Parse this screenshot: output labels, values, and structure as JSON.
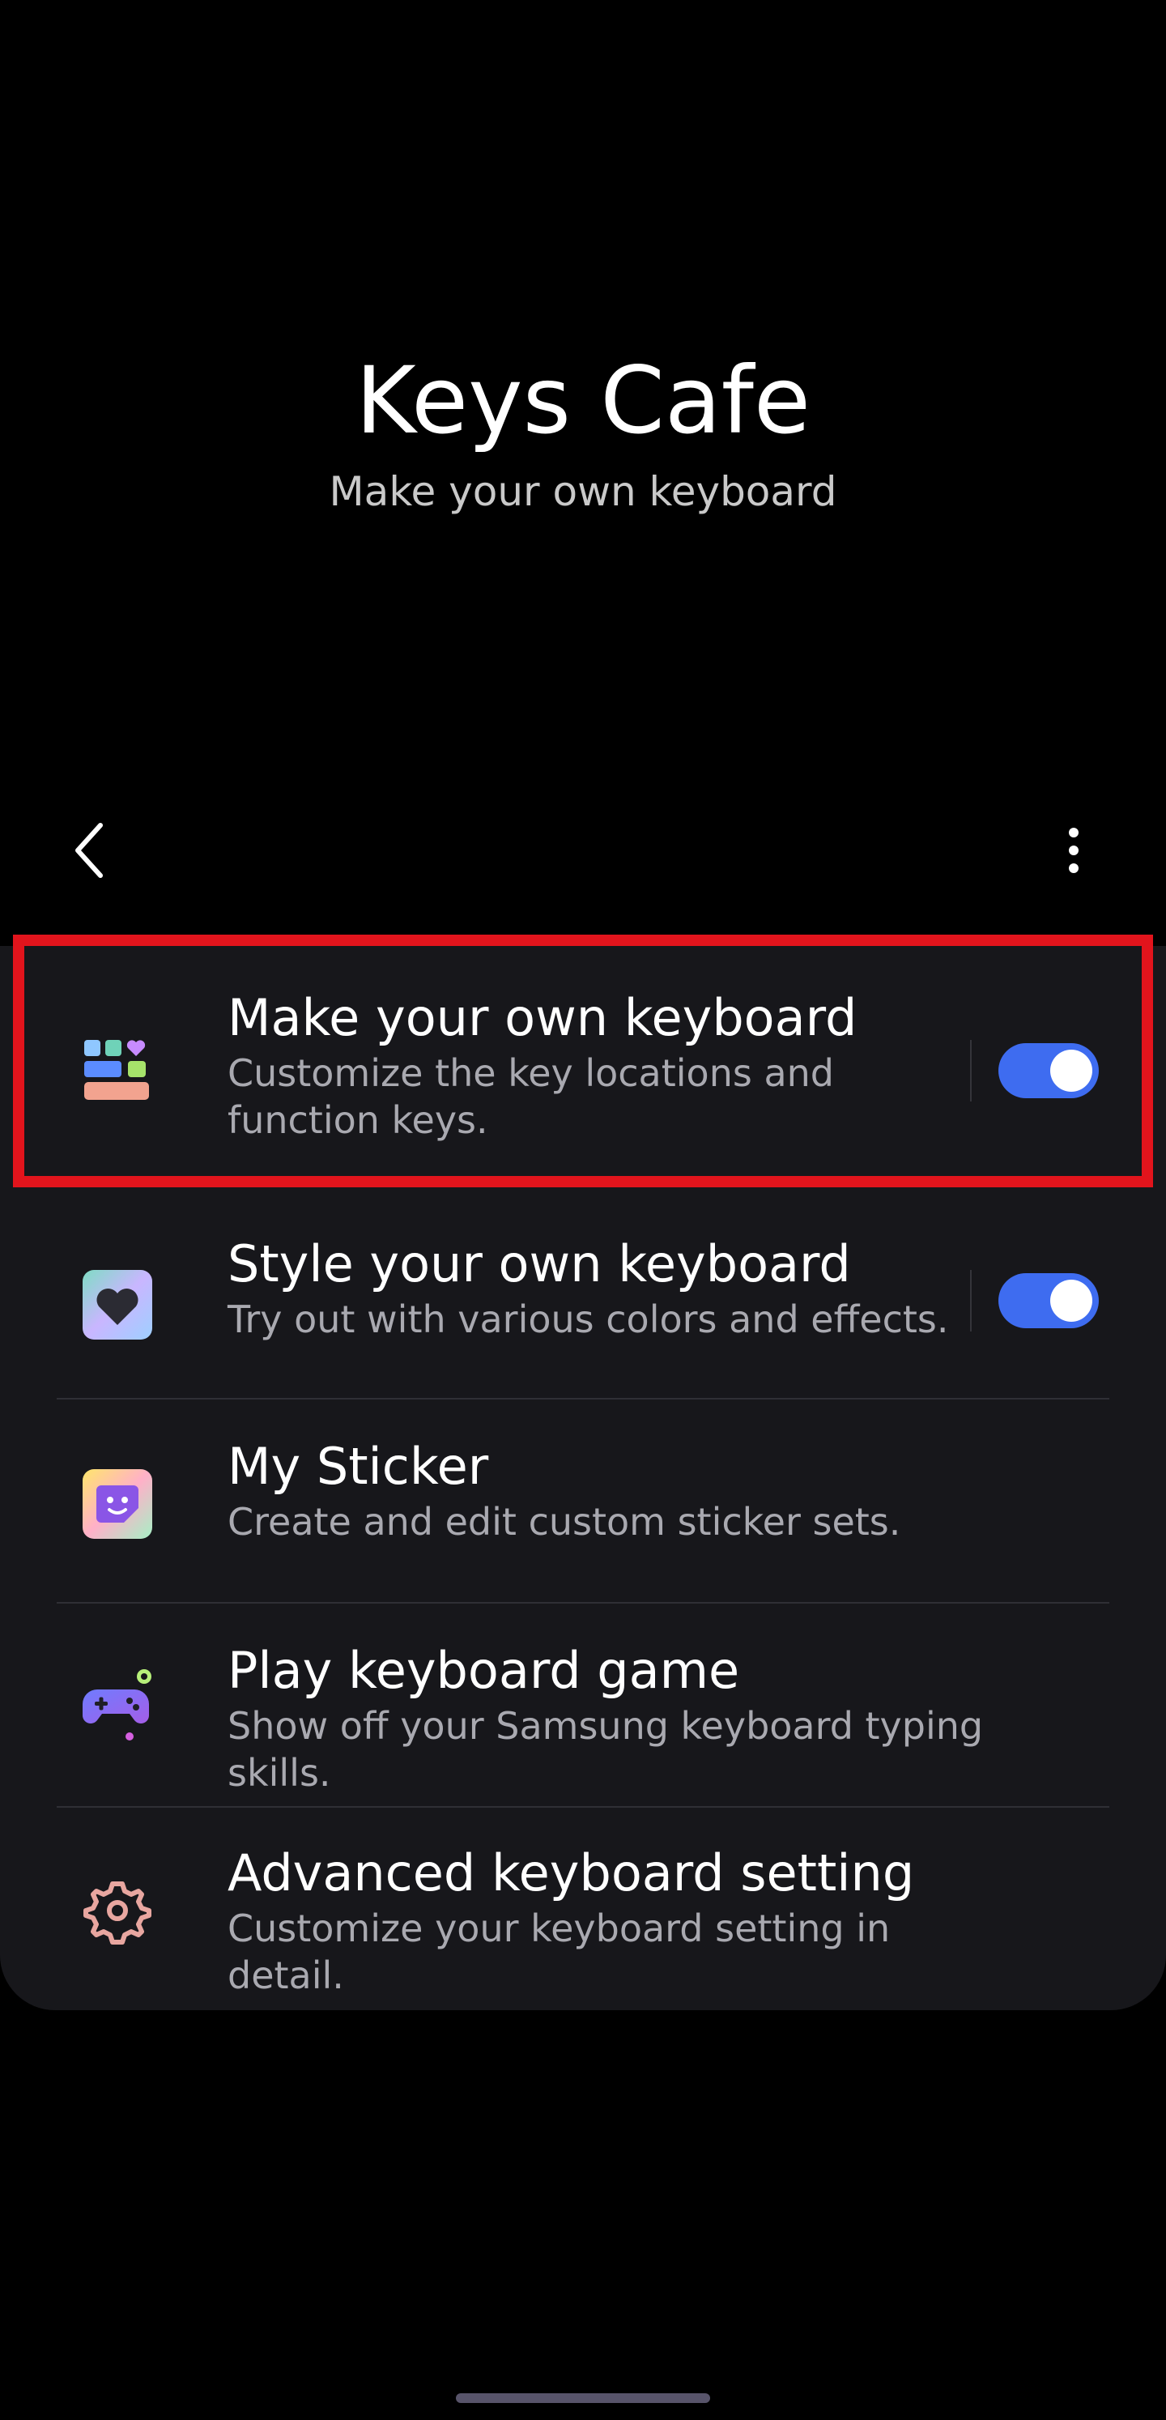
{
  "header": {
    "title": "Keys Cafe",
    "subtitle": "Make your own keyboard"
  },
  "toolbar": {
    "back_icon": "chevron-left-icon",
    "more_icon": "more-vertical-icon"
  },
  "items": [
    {
      "title": "Make your own keyboard",
      "description": "Customize the key locations and function keys.",
      "icon": "keyboard-layout-icon",
      "toggle": true,
      "highlighted": true
    },
    {
      "title": "Style your own keyboard",
      "description": "Try out with various colors and effects.",
      "icon": "heart-palette-icon",
      "toggle": true
    },
    {
      "title": "My Sticker",
      "description": "Create and edit custom sticker sets.",
      "icon": "sticker-icon"
    },
    {
      "title": "Play keyboard game",
      "description": "Show off your Samsung keyboard typing skills.",
      "icon": "gamepad-icon"
    },
    {
      "title": "Advanced keyboard setting",
      "description": "Customize your keyboard setting in detail.",
      "icon": "gear-icon"
    }
  ],
  "colors": {
    "accent": "#3e6cf0",
    "highlight": "#e2141c",
    "panel": "#17171b"
  }
}
